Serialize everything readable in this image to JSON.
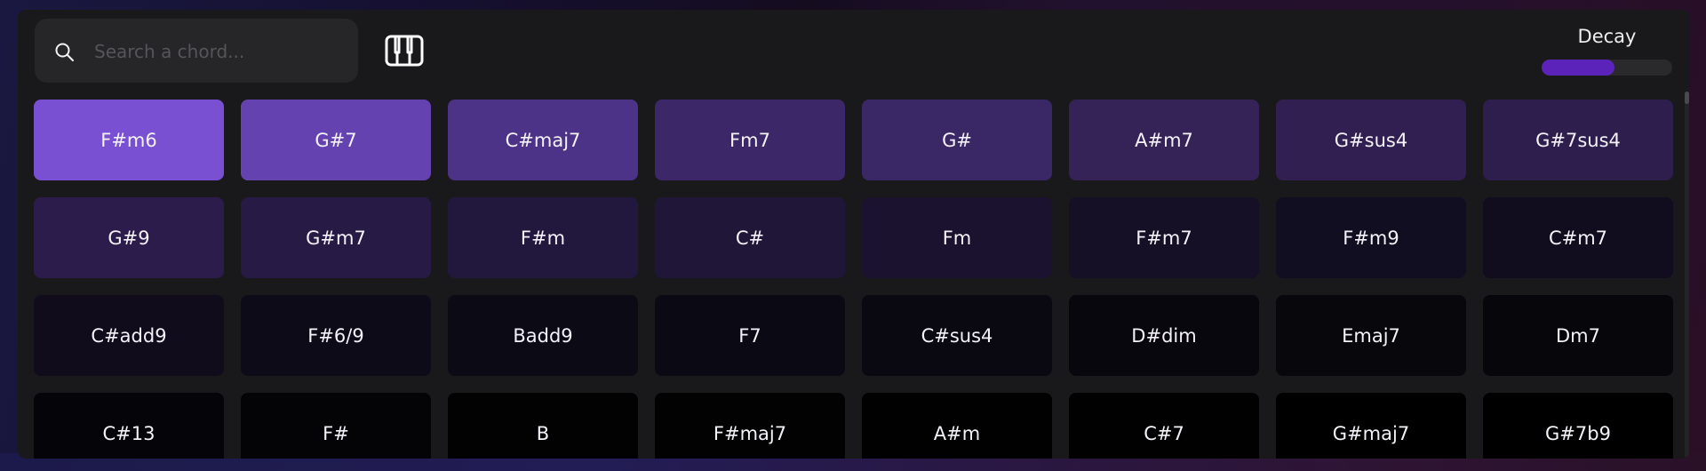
{
  "search": {
    "placeholder": "Search a chord...",
    "value": "",
    "icon": "search-icon"
  },
  "piano_button": {
    "icon": "piano-icon"
  },
  "decay": {
    "label": "Decay",
    "value": 0.56,
    "fill_color": "#5b23b9"
  },
  "chords": [
    {
      "label": "F#m6",
      "color": "#7950d2"
    },
    {
      "label": "G#7",
      "color": "#6443b0"
    },
    {
      "label": "C#maj7",
      "color": "#4c3388"
    },
    {
      "label": "Fm7",
      "color": "#3c2769"
    },
    {
      "label": "G#",
      "color": "#3a2766"
    },
    {
      "label": "A#m7",
      "color": "#352358"
    },
    {
      "label": "G#sus4",
      "color": "#311f52"
    },
    {
      "label": "G#7sus4",
      "color": "#2d1e4d"
    },
    {
      "label": "G#9",
      "color": "#2c1c4b"
    },
    {
      "label": "G#m7",
      "color": "#271a44"
    },
    {
      "label": "F#m",
      "color": "#22183d"
    },
    {
      "label": "C#",
      "color": "#201638"
    },
    {
      "label": "Fm",
      "color": "#1a122e"
    },
    {
      "label": "F#m7",
      "color": "#161027"
    },
    {
      "label": "F#m9",
      "color": "#120e21"
    },
    {
      "label": "C#m7",
      "color": "#110c1e"
    },
    {
      "label": "C#add9",
      "color": "#100c1c"
    },
    {
      "label": "F#6/9",
      "color": "#0e0b18"
    },
    {
      "label": "Badd9",
      "color": "#0c0a15"
    },
    {
      "label": "F7",
      "color": "#0b0913"
    },
    {
      "label": "C#sus4",
      "color": "#0a0811"
    },
    {
      "label": "D#dim",
      "color": "#09070e"
    },
    {
      "label": "Emaj7",
      "color": "#08070c"
    },
    {
      "label": "Dm7",
      "color": "#07060a"
    },
    {
      "label": "C#13",
      "color": "#050408"
    },
    {
      "label": "F#",
      "color": "#040306"
    },
    {
      "label": "B",
      "color": "#020203"
    },
    {
      "label": "F#maj7",
      "color": "#020202"
    },
    {
      "label": "A#m",
      "color": "#010101"
    },
    {
      "label": "C#7",
      "color": "#010101"
    },
    {
      "label": "G#maj7",
      "color": "#000000"
    },
    {
      "label": "G#7b9",
      "color": "#000000"
    }
  ]
}
